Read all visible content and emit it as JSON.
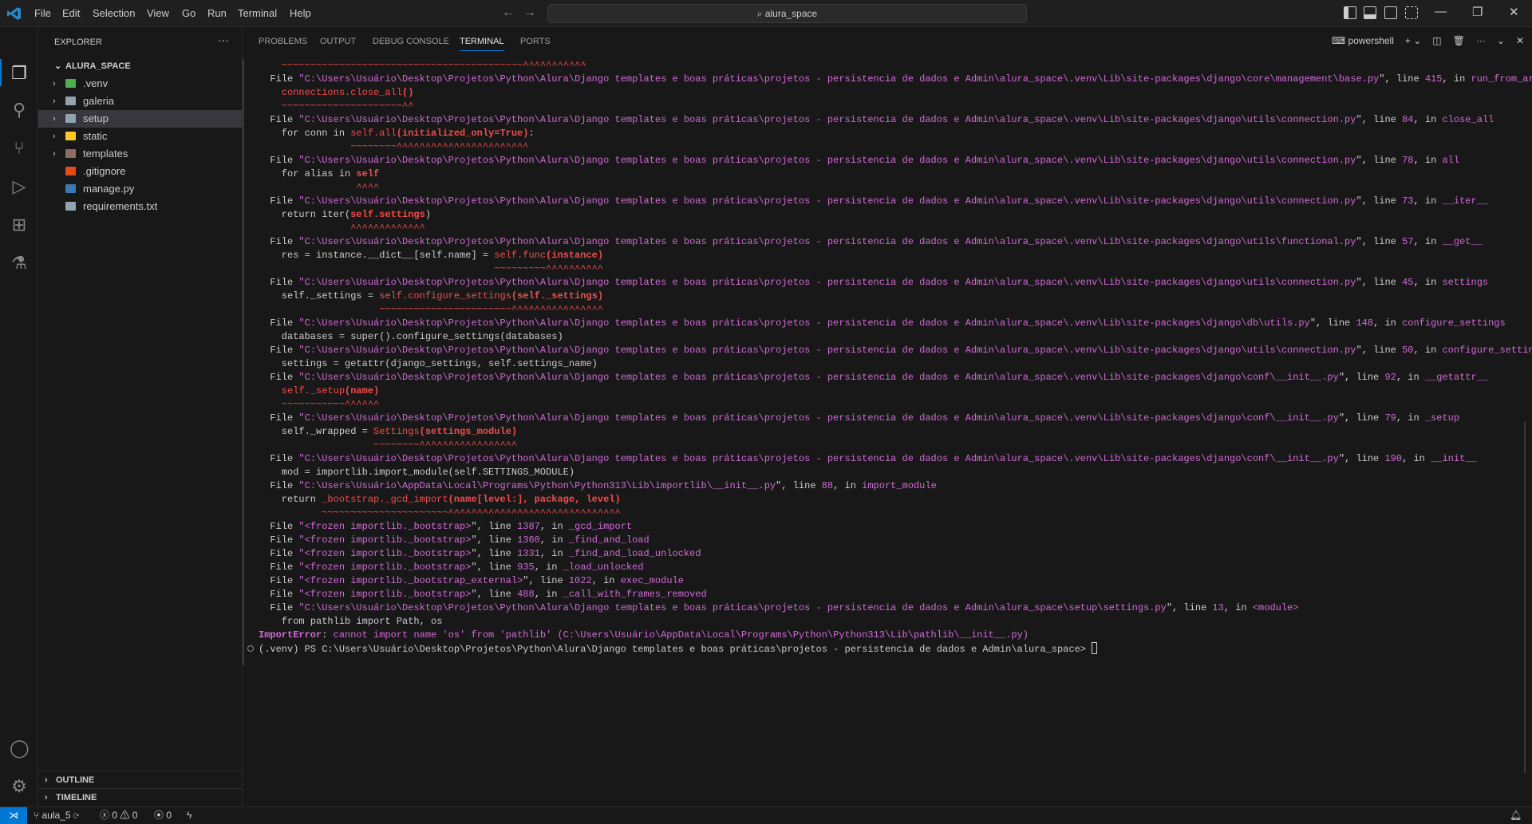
{
  "titlebar": {
    "menu": [
      "File",
      "Edit",
      "Selection",
      "View",
      "Go",
      "Run",
      "Terminal",
      "Help"
    ],
    "search": "alura_space"
  },
  "sidebar": {
    "title": "EXPLORER",
    "root": "ALURA_SPACE",
    "items": [
      {
        "label": ".venv",
        "folder": true,
        "color": "#4caf50"
      },
      {
        "label": "galeria",
        "folder": true,
        "color": "#90a4ae"
      },
      {
        "label": "setup",
        "folder": true,
        "color": "#90a4ae",
        "selected": true
      },
      {
        "label": "static",
        "folder": true,
        "color": "#ffca28"
      },
      {
        "label": "templates",
        "folder": true,
        "color": "#8d6e63"
      },
      {
        "label": ".gitignore",
        "folder": false,
        "color": "#e64a19"
      },
      {
        "label": "manage.py",
        "folder": false,
        "color": "#3b78b5"
      },
      {
        "label": "requirements.txt",
        "folder": false,
        "color": "#90a4ae"
      }
    ],
    "outline": "OUTLINE",
    "timeline": "TIMELINE"
  },
  "panel": {
    "tabs": [
      "PROBLEMS",
      "OUTPUT",
      "DEBUG CONSOLE",
      "TERMINAL",
      "PORTS"
    ],
    "active_tab": "TERMINAL",
    "shell": "powershell"
  },
  "terminal": {
    "lines": [
      {
        "segs": [
          [
            "    ~~~~~~~~~~~~~~~~~~~~~~~~~~~~~~~~~~~~~~~~~~^^^^^^^^^^^",
            "r"
          ]
        ]
      },
      {
        "file": {
          "path": "C:\\Users\\Usuário\\Desktop\\Projetos\\Python\\Alura\\Django templates e boas práticas\\projetos - persistencia de dados e Admin\\alura_space\\.venv\\Lib\\site-packages\\django\\core\\management\\base.py",
          "line": "415",
          "func": "run_from_argv"
        }
      },
      {
        "segs": [
          [
            "    connections.close_all",
            "r"
          ],
          [
            "()",
            "R"
          ]
        ]
      },
      {
        "segs": [
          [
            "    ~~~~~~~~~~~~~~~~~~~~~^^",
            "r"
          ]
        ]
      },
      {
        "file": {
          "path": "C:\\Users\\Usuário\\Desktop\\Projetos\\Python\\Alura\\Django templates e boas práticas\\projetos - persistencia de dados e Admin\\alura_space\\.venv\\Lib\\site-packages\\django\\utils\\connection.py",
          "line": "84",
          "func": "close_all"
        }
      },
      {
        "segs": [
          [
            "    for conn in ",
            "w"
          ],
          [
            "self.all",
            "r"
          ],
          [
            "(initialized_only=True)",
            "R"
          ],
          [
            ":",
            "w"
          ]
        ]
      },
      {
        "segs": [
          [
            "                ~~~~~~~~^^^^^^^^^^^^^^^^^^^^^^^",
            "r"
          ]
        ]
      },
      {
        "file": {
          "path": "C:\\Users\\Usuário\\Desktop\\Projetos\\Python\\Alura\\Django templates e boas práticas\\projetos - persistencia de dados e Admin\\alura_space\\.venv\\Lib\\site-packages\\django\\utils\\connection.py",
          "line": "78",
          "func": "all"
        }
      },
      {
        "segs": [
          [
            "    for alias in ",
            "w"
          ],
          [
            "self",
            "R"
          ]
        ]
      },
      {
        "segs": [
          [
            "                 ^^^^",
            "r"
          ]
        ]
      },
      {
        "file": {
          "path": "C:\\Users\\Usuário\\Desktop\\Projetos\\Python\\Alura\\Django templates e boas práticas\\projetos - persistencia de dados e Admin\\alura_space\\.venv\\Lib\\site-packages\\django\\utils\\connection.py",
          "line": "73",
          "func": "__iter__"
        }
      },
      {
        "segs": [
          [
            "    return iter(",
            "w"
          ],
          [
            "self.settings",
            "R"
          ],
          [
            ")",
            "w"
          ]
        ]
      },
      {
        "segs": [
          [
            "                ^^^^^^^^^^^^^",
            "r"
          ]
        ]
      },
      {
        "file": {
          "path": "C:\\Users\\Usuário\\Desktop\\Projetos\\Python\\Alura\\Django templates e boas práticas\\projetos - persistencia de dados e Admin\\alura_space\\.venv\\Lib\\site-packages\\django\\utils\\functional.py",
          "line": "57",
          "func": "__get__"
        }
      },
      {
        "segs": [
          [
            "    res = instance.__dict__[self.name] = ",
            "w"
          ],
          [
            "self.func",
            "r"
          ],
          [
            "(instance)",
            "R"
          ]
        ]
      },
      {
        "segs": [
          [
            "                                         ~~~~~~~~~^^^^^^^^^^",
            "r"
          ]
        ]
      },
      {
        "file": {
          "path": "C:\\Users\\Usuário\\Desktop\\Projetos\\Python\\Alura\\Django templates e boas práticas\\projetos - persistencia de dados e Admin\\alura_space\\.venv\\Lib\\site-packages\\django\\utils\\connection.py",
          "line": "45",
          "func": "settings"
        }
      },
      {
        "segs": [
          [
            "    self._settings = ",
            "w"
          ],
          [
            "self.configure_settings",
            "r"
          ],
          [
            "(self._settings)",
            "R"
          ]
        ]
      },
      {
        "segs": [
          [
            "                     ~~~~~~~~~~~~~~~~~~~~~~~^^^^^^^^^^^^^^^^",
            "r"
          ]
        ]
      },
      {
        "file": {
          "path": "C:\\Users\\Usuário\\Desktop\\Projetos\\Python\\Alura\\Django templates e boas práticas\\projetos - persistencia de dados e Admin\\alura_space\\.venv\\Lib\\site-packages\\django\\db\\utils.py",
          "line": "148",
          "func": "configure_settings"
        }
      },
      {
        "segs": [
          [
            "    databases = super().configure_settings(databases)",
            "w"
          ]
        ]
      },
      {
        "file": {
          "path": "C:\\Users\\Usuário\\Desktop\\Projetos\\Python\\Alura\\Django templates e boas práticas\\projetos - persistencia de dados e Admin\\alura_space\\.venv\\Lib\\site-packages\\django\\utils\\connection.py",
          "line": "50",
          "func": "configure_settings"
        }
      },
      {
        "segs": [
          [
            "    settings = getattr(django_settings, self.settings_name)",
            "w"
          ]
        ]
      },
      {
        "file": {
          "path": "C:\\Users\\Usuário\\Desktop\\Projetos\\Python\\Alura\\Django templates e boas práticas\\projetos - persistencia de dados e Admin\\alura_space\\.venv\\Lib\\site-packages\\django\\conf\\__init__.py",
          "line": "92",
          "func": "__getattr__"
        }
      },
      {
        "segs": [
          [
            "    self._setup",
            "r"
          ],
          [
            "(name)",
            "R"
          ]
        ]
      },
      {
        "segs": [
          [
            "    ~~~~~~~~~~~^^^^^^",
            "r"
          ]
        ]
      },
      {
        "file": {
          "path": "C:\\Users\\Usuário\\Desktop\\Projetos\\Python\\Alura\\Django templates e boas práticas\\projetos - persistencia de dados e Admin\\alura_space\\.venv\\Lib\\site-packages\\django\\conf\\__init__.py",
          "line": "79",
          "func": "_setup"
        }
      },
      {
        "segs": [
          [
            "    self._wrapped = ",
            "w"
          ],
          [
            "Settings",
            "r"
          ],
          [
            "(settings_module)",
            "R"
          ]
        ]
      },
      {
        "segs": [
          [
            "                    ~~~~~~~~^^^^^^^^^^^^^^^^^",
            "r"
          ]
        ]
      },
      {
        "file": {
          "path": "C:\\Users\\Usuário\\Desktop\\Projetos\\Python\\Alura\\Django templates e boas práticas\\projetos - persistencia de dados e Admin\\alura_space\\.venv\\Lib\\site-packages\\django\\conf\\__init__.py",
          "line": "190",
          "func": "__init__"
        }
      },
      {
        "segs": [
          [
            "    mod = importlib.import_module(self.SETTINGS_MODULE)",
            "w"
          ]
        ]
      },
      {
        "file": {
          "path": "C:\\Users\\Usuário\\AppData\\Local\\Programs\\Python\\Python313\\Lib\\importlib\\__init__.py",
          "line": "88",
          "func": "import_module"
        }
      },
      {
        "segs": [
          [
            "    return ",
            "w"
          ],
          [
            "_bootstrap._gcd_import",
            "r"
          ],
          [
            "(name[level:], package, level)",
            "R"
          ]
        ]
      },
      {
        "segs": [
          [
            "           ~~~~~~~~~~~~~~~~~~~~~~^^^^^^^^^^^^^^^^^^^^^^^^^^^^^^",
            "r"
          ]
        ]
      },
      {
        "file": {
          "path": "<frozen importlib._bootstrap>",
          "line": "1387",
          "func": "_gcd_import"
        }
      },
      {
        "file": {
          "path": "<frozen importlib._bootstrap>",
          "line": "1360",
          "func": "_find_and_load"
        }
      },
      {
        "file": {
          "path": "<frozen importlib._bootstrap>",
          "line": "1331",
          "func": "_find_and_load_unlocked"
        }
      },
      {
        "file": {
          "path": "<frozen importlib._bootstrap>",
          "line": "935",
          "func": "_load_unlocked"
        }
      },
      {
        "file": {
          "path": "<frozen importlib._bootstrap_external>",
          "line": "1022",
          "func": "exec_module"
        }
      },
      {
        "file": {
          "path": "<frozen importlib._bootstrap>",
          "line": "488",
          "func": "_call_with_frames_removed"
        }
      },
      {
        "file": {
          "path": "C:\\Users\\Usuário\\Desktop\\Projetos\\Python\\Alura\\Django templates e boas práticas\\projetos - persistencia de dados e Admin\\alura_space\\setup\\settings.py",
          "line": "13",
          "func": "<module>"
        }
      },
      {
        "segs": [
          [
            "    from pathlib import Path, os",
            "w"
          ]
        ]
      },
      {
        "segs": [
          [
            "ImportError",
            "M"
          ],
          [
            ": ",
            "w"
          ],
          [
            "cannot import name 'os' from 'pathlib' (C:\\Users\\Usuário\\AppData\\Local\\Programs\\Python\\Python313\\Lib\\pathlib\\__init__.py)",
            "m"
          ]
        ]
      },
      {
        "prompt": "(.venv) PS C:\\Users\\Usuário\\Desktop\\Projetos\\Python\\Alura\\Django templates e boas práticas\\projetos - persistencia de dados e Admin\\alura_space> "
      }
    ],
    "file_word": "  File ",
    "line_word": "\", line ",
    "in_word": ", in "
  },
  "statusbar": {
    "branch": "aula_5",
    "errors": "0",
    "warnings": "0",
    "ports": "0"
  },
  "colors": {
    "accent": "#0078d4",
    "magenta": "#d06bd6",
    "red": "#f14c4c"
  }
}
